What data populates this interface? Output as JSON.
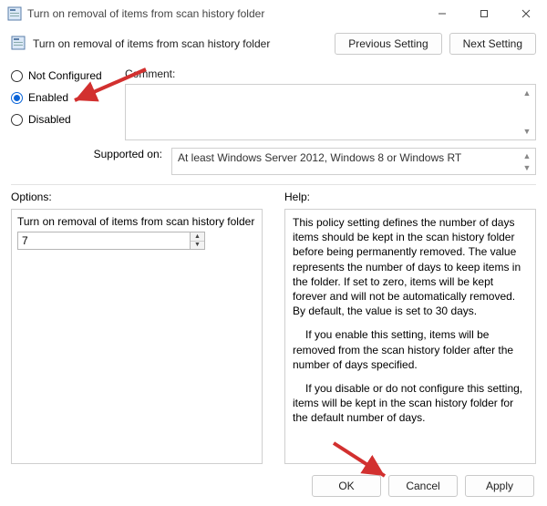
{
  "window": {
    "title": "Turn on removal of items from scan history folder"
  },
  "header": {
    "title": "Turn on removal of items from scan history folder",
    "prev_label": "Previous Setting",
    "next_label": "Next Setting"
  },
  "radios": {
    "not_configured": "Not Configured",
    "enabled": "Enabled",
    "disabled": "Disabled",
    "selected": "enabled"
  },
  "comment": {
    "label": "Comment:",
    "value": ""
  },
  "supported": {
    "label": "Supported on:",
    "value": "At least Windows Server 2012, Windows 8 or Windows RT"
  },
  "options": {
    "label": "Options:",
    "item_label": "Turn on removal of items from scan history folder",
    "value": "7"
  },
  "help": {
    "label": "Help:",
    "p1": "This policy setting defines the number of days items should be kept in the scan history folder before being permanently removed. The value represents the number of days to keep items in the folder. If set to zero, items will be kept forever and will not be automatically removed. By default, the value is set to 30 days.",
    "p2": "If you enable this setting, items will be removed from the scan history folder after the number of days specified.",
    "p3": "If you disable or do not configure this setting, items will be kept in the scan history folder for the default number of days."
  },
  "footer": {
    "ok": "OK",
    "cancel": "Cancel",
    "apply": "Apply"
  },
  "colors": {
    "accent": "#0a64d8",
    "arrow": "#d2302f"
  }
}
